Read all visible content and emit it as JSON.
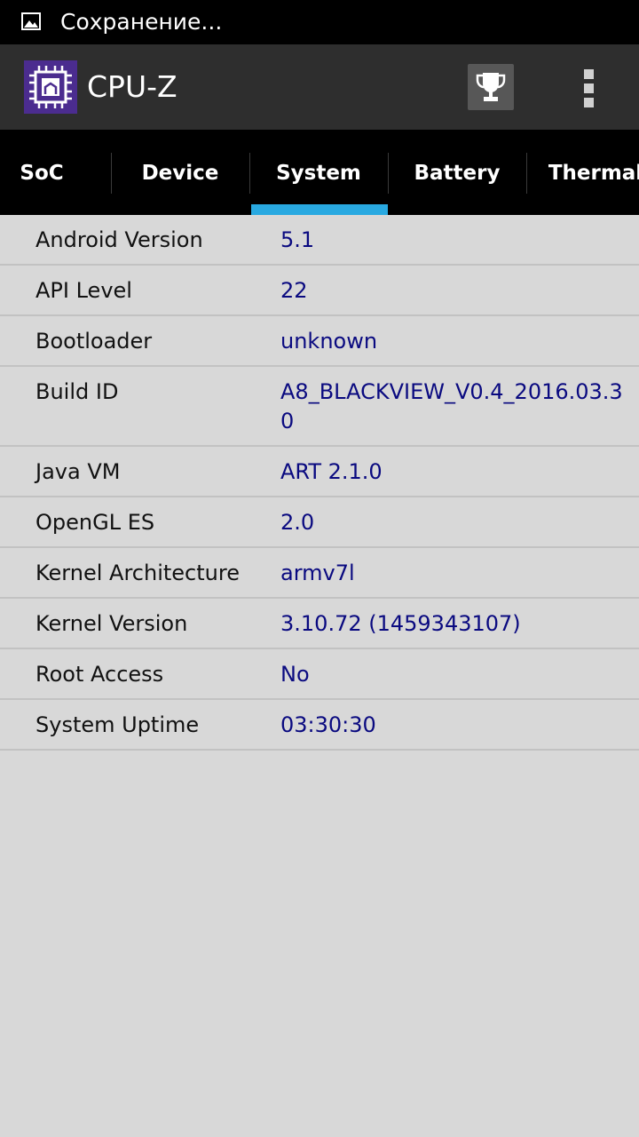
{
  "status_bar": {
    "notification_icon": "image-icon",
    "text": "Сохранение..."
  },
  "app_bar": {
    "title": "CPU-Z",
    "logo_icon": "cpu-chip-icon",
    "trophy_icon": "trophy-icon",
    "overflow_icon": "more-vertical-icon"
  },
  "tabs": [
    {
      "label": "SoC",
      "selected": false
    },
    {
      "label": "Device",
      "selected": false
    },
    {
      "label": "System",
      "selected": true
    },
    {
      "label": "Battery",
      "selected": false
    },
    {
      "label": "Thermal",
      "selected": false
    }
  ],
  "colors": {
    "accent": "#29a9e1",
    "value_text": "#0a0a80",
    "logo_purple": "#4b2c8f"
  },
  "system_info": [
    {
      "label": "Android Version",
      "value": "5.1"
    },
    {
      "label": "API Level",
      "value": "22"
    },
    {
      "label": "Bootloader",
      "value": "unknown"
    },
    {
      "label": "Build ID",
      "value": "A8_BLACKVIEW_V0.4_2016.03.30"
    },
    {
      "label": "Java VM",
      "value": "ART 2.1.0"
    },
    {
      "label": "OpenGL ES",
      "value": "2.0"
    },
    {
      "label": "Kernel Architecture",
      "value": "armv7l"
    },
    {
      "label": "Kernel Version",
      "value": "3.10.72 (1459343107)"
    },
    {
      "label": "Root Access",
      "value": "No"
    },
    {
      "label": "System Uptime",
      "value": "03:30:30"
    }
  ]
}
